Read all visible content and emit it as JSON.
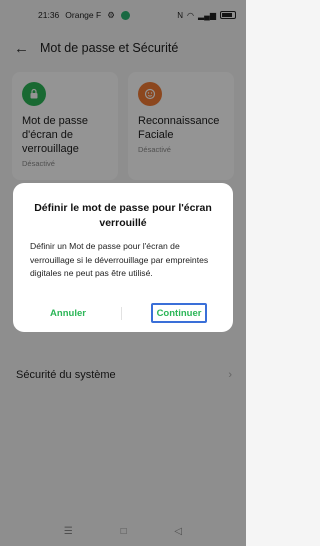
{
  "status_bar": {
    "time": "21:36",
    "carrier": "Orange F",
    "right_text": "N"
  },
  "header": {
    "back_icon": "arrow-left-icon",
    "title": "Mot de passe et Sécurité"
  },
  "cards": [
    {
      "icon": "lock-icon",
      "icon_color": "#2bb657",
      "title": "Mot de passe d'écran de verrouillage",
      "status": "Désactivé"
    },
    {
      "icon": "face-icon",
      "icon_color": "#f17a35",
      "title": "Reconnaissance Faciale",
      "status": "Désactivé"
    }
  ],
  "system_security": {
    "label": "Sécurité du système"
  },
  "dialog": {
    "title": "Définir le mot de passe pour l'écran verrouillé",
    "message": "Définir un Mot de passe pour l'écran de verrouillage si le déverrouillage par empreintes digitales ne peut pas être utilisé.",
    "cancel_label": "Annuler",
    "continue_label": "Continuer",
    "accent_color": "#2bb657"
  },
  "nav_bar": {
    "menu_icon": "menu-icon",
    "home_icon": "home-icon",
    "back_icon": "back-triangle-icon"
  }
}
